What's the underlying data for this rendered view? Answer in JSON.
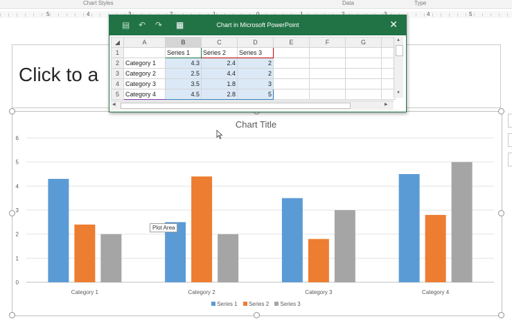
{
  "ribbon": {
    "group1": "Chart Styles",
    "group2": "Data",
    "group3": "Type"
  },
  "ruler": {
    "labels": [
      "5",
      "4",
      "3",
      "2",
      "1",
      "0",
      "1",
      "2",
      "3",
      "4",
      "5"
    ]
  },
  "slide": {
    "title_placeholder": "Click to a"
  },
  "tooltip": "Plot Area",
  "excel": {
    "title": "Chart in Microsoft PowerPoint",
    "close": "✕",
    "columns": [
      "A",
      "B",
      "C",
      "D",
      "E",
      "F",
      "G"
    ],
    "rows": [
      {
        "n": "1",
        "a": "",
        "b": "Series 1",
        "c": "Series 2",
        "d": "Series 3"
      },
      {
        "n": "2",
        "a": "Category 1",
        "b": "4.3",
        "c": "2.4",
        "d": "2"
      },
      {
        "n": "3",
        "a": "Category 2",
        "b": "2.5",
        "c": "4.4",
        "d": "2"
      },
      {
        "n": "4",
        "a": "Category 3",
        "b": "3.5",
        "c": "1.8",
        "d": "3"
      },
      {
        "n": "5",
        "a": "Category 4",
        "b": "4.5",
        "c": "2.8",
        "d": "5"
      }
    ],
    "icons": [
      "save-icon",
      "undo-icon",
      "redo-icon",
      "excel-icon"
    ]
  },
  "chart_data": {
    "type": "bar",
    "title": "Chart Title",
    "categories": [
      "Category 1",
      "Category 2",
      "Category 3",
      "Category 4"
    ],
    "series": [
      {
        "name": "Series 1",
        "values": [
          4.3,
          2.5,
          3.5,
          4.5
        ],
        "color": "#5b9bd5"
      },
      {
        "name": "Series 2",
        "values": [
          2.4,
          4.4,
          1.8,
          2.8
        ],
        "color": "#ed7d31"
      },
      {
        "name": "Series 3",
        "values": [
          2,
          2,
          3,
          5
        ],
        "color": "#a5a5a5"
      }
    ],
    "ylim": [
      0,
      6
    ],
    "yticks": [
      "0",
      "1",
      "2",
      "3",
      "4",
      "5",
      "6"
    ],
    "grid": true,
    "legend": "bottom"
  }
}
